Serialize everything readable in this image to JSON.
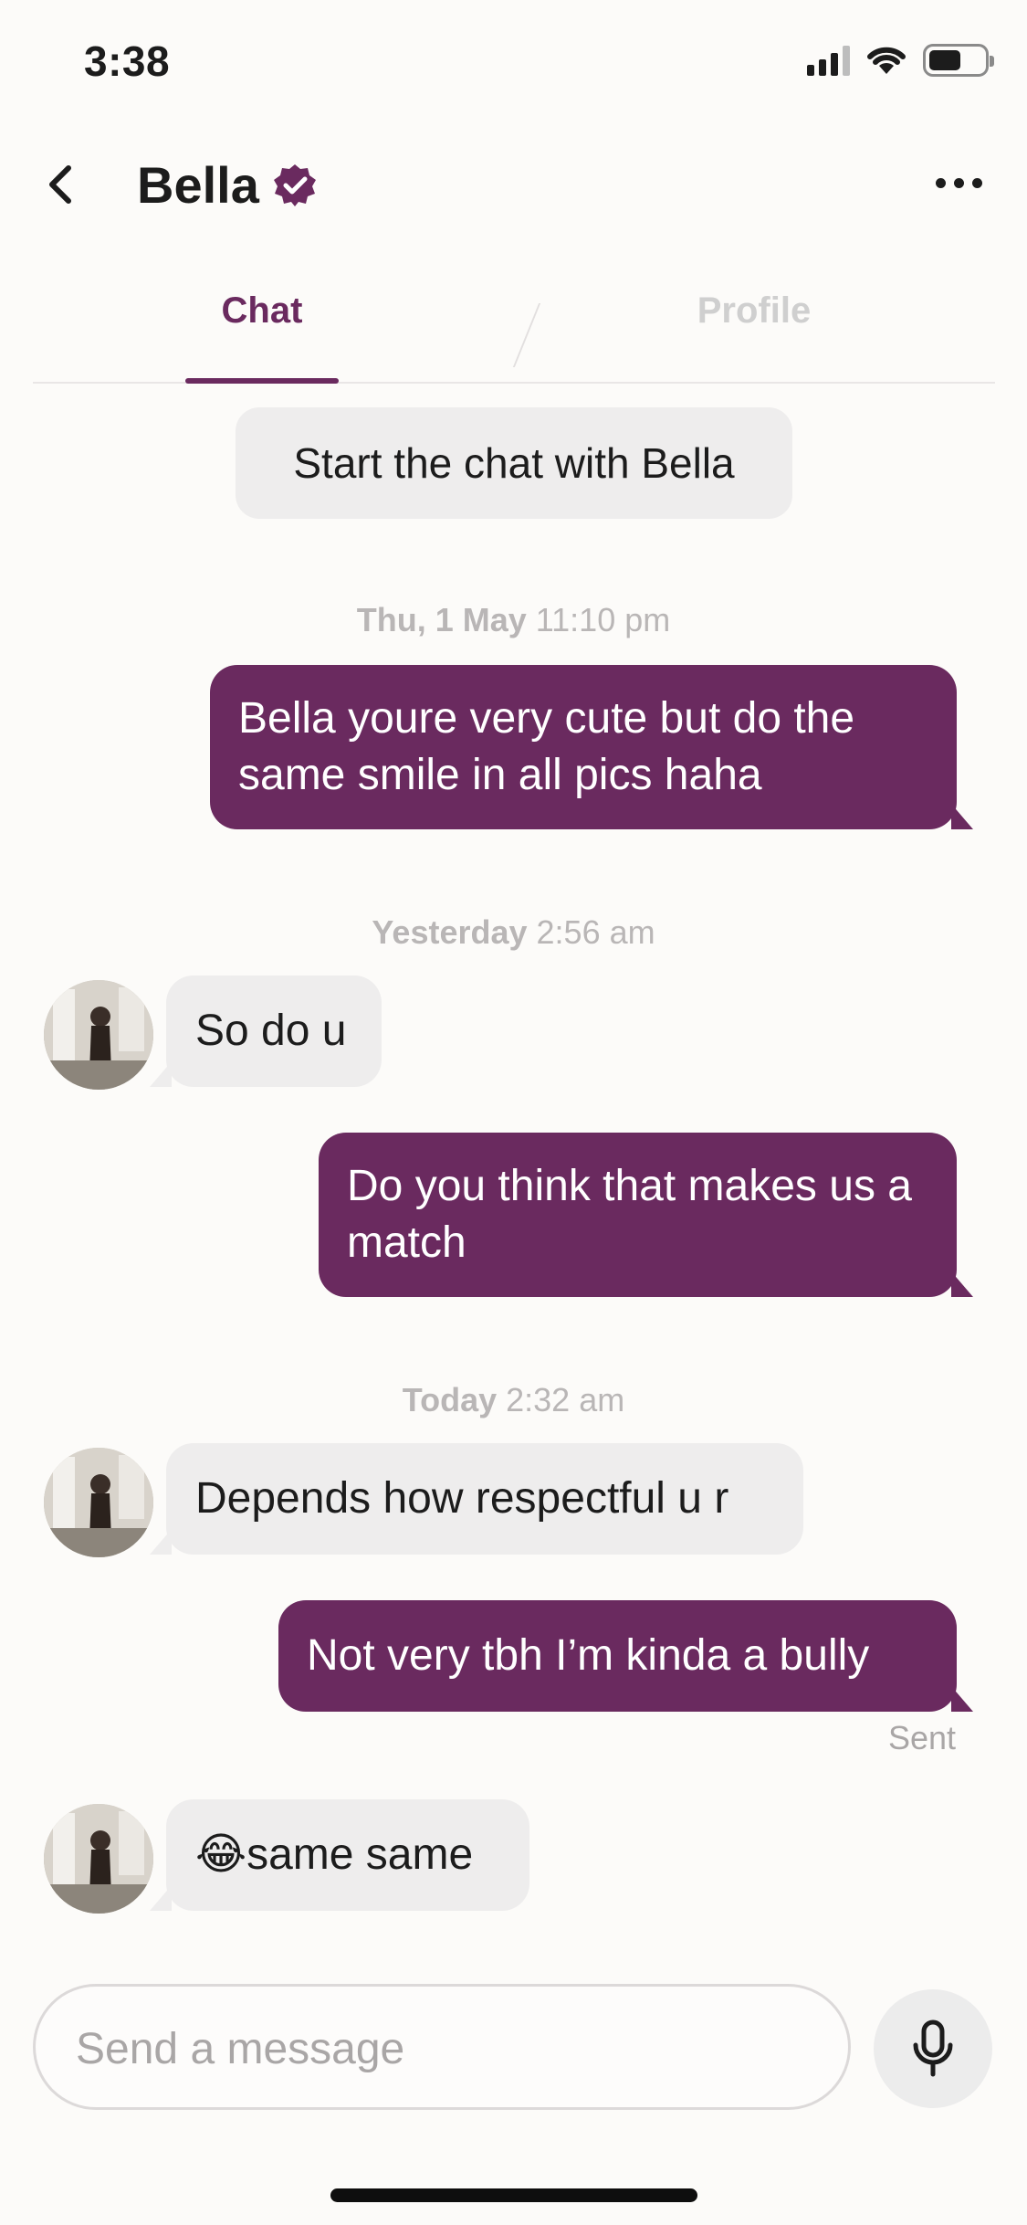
{
  "status_bar": {
    "time": "3:38"
  },
  "header": {
    "title": "Bella"
  },
  "tabs": [
    {
      "label": "Chat",
      "active": true
    },
    {
      "label": "Profile",
      "active": false
    }
  ],
  "chat": {
    "start_chip": "Start the chat with Bella",
    "groups": [
      {
        "day": "Thu, 1 May",
        "time": "11:10 pm"
      },
      {
        "day": "Yesterday",
        "time": "2:56 am"
      },
      {
        "day": "Today",
        "time": "2:32 am"
      }
    ],
    "messages": [
      {
        "from": "me",
        "text": "Bella youre very cute but do the same smile in all pics haha"
      },
      {
        "from": "them",
        "text": "So do u"
      },
      {
        "from": "me",
        "text": "Do you think that makes us a match"
      },
      {
        "from": "them",
        "text": "Depends how respectful u r"
      },
      {
        "from": "me",
        "text": "Not very tbh I’m kinda a bully"
      },
      {
        "from": "them",
        "text": "😂same same"
      }
    ],
    "sent_status": "Sent"
  },
  "composer": {
    "placeholder": "Send a message"
  },
  "colors": {
    "accent": "#6a2a5f",
    "incoming_bubble": "#eeeded",
    "background": "#fcfbf9",
    "muted_text": "#b9b6b6"
  },
  "icons": {
    "back": "chevron-left-icon",
    "verified": "verified-badge-icon",
    "more": "more-horizontal-icon",
    "mic": "microphone-icon"
  }
}
